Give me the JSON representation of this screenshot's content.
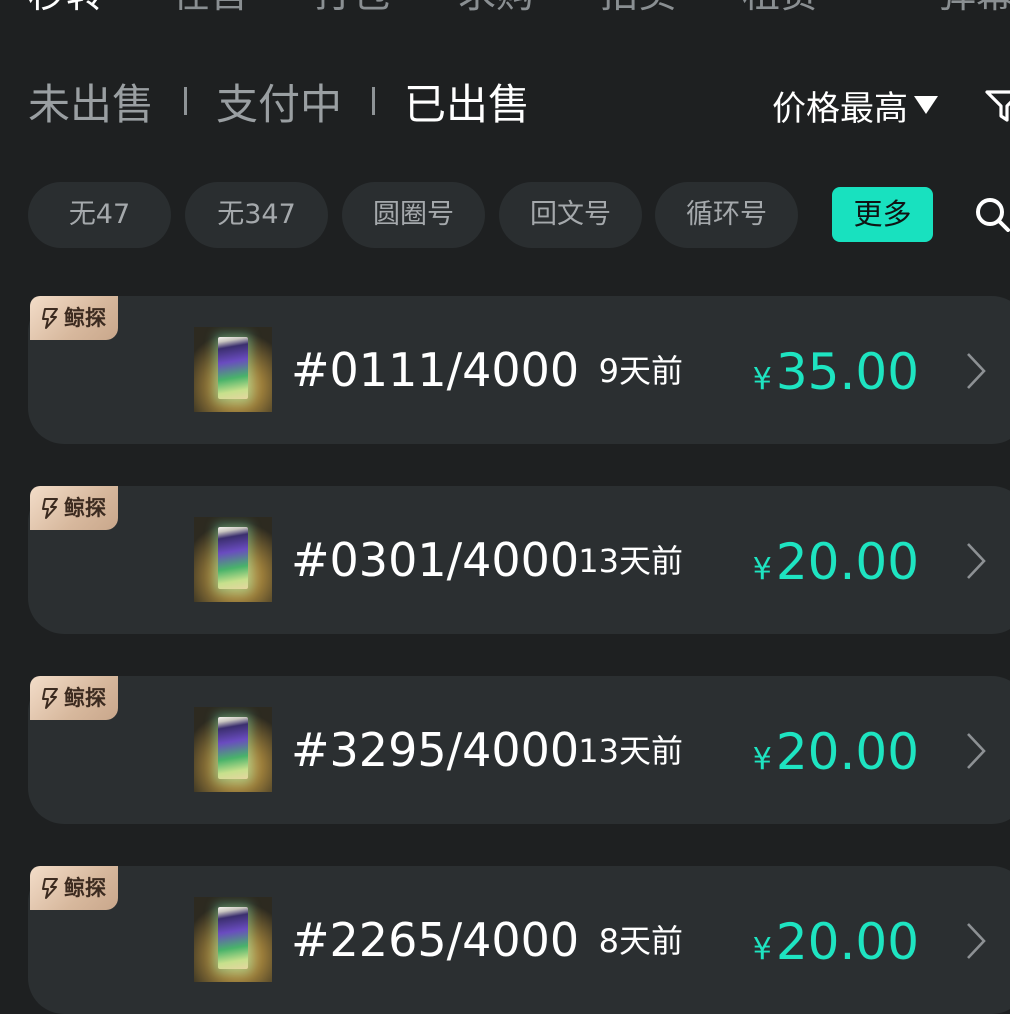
{
  "top_tabs": [
    "秒转",
    "在售",
    "打包",
    "求购",
    "拍卖",
    "租赁",
    "弹幕"
  ],
  "status_tabs": [
    "未出售",
    "支付中",
    "已出售"
  ],
  "sort": {
    "label": "价格最高"
  },
  "chips": [
    "无47",
    "无347",
    "圆圈号",
    "回文号",
    "循环号"
  ],
  "more_label": "更多",
  "currency_symbol": "¥",
  "badge_text": "鲸探",
  "items": [
    {
      "serial": "#0111/4000",
      "time": "9天前",
      "price": "35.00"
    },
    {
      "serial": "#0301/4000",
      "time": "13天前",
      "price": "20.00"
    },
    {
      "serial": "#3295/4000",
      "time": "13天前",
      "price": "20.00"
    },
    {
      "serial": "#2265/4000",
      "time": "8天前",
      "price": "20.00"
    }
  ],
  "colors": {
    "background": "#1e2021",
    "card": "#2b2f31",
    "accent": "#18e1bf",
    "badge": "#e2c4a8"
  }
}
